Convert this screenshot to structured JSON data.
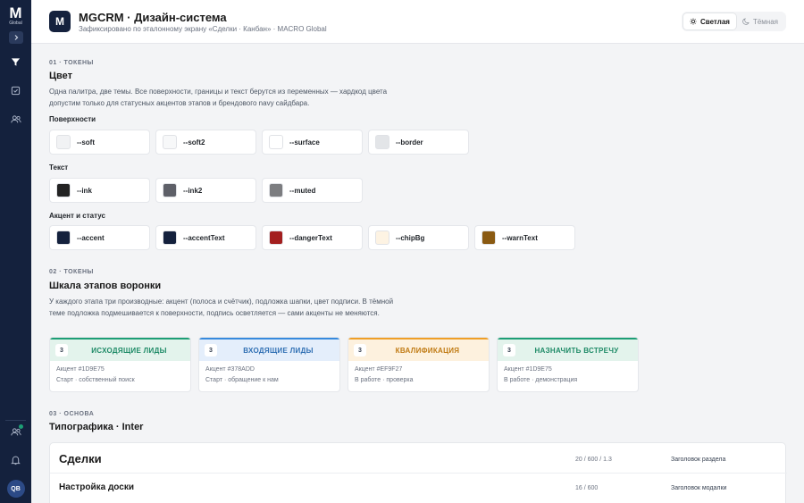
{
  "sidebar": {
    "logo_letter": "M",
    "logo_sub": "Global",
    "avatar": "QB"
  },
  "header": {
    "brand_letter": "M",
    "title": "MGCRM · Дизайн-система",
    "subtitle": "Зафиксировано по эталонному экрану «Сделки · Канбан» · MACRO Global",
    "theme_light": "Светлая",
    "theme_dark": "Тёмная"
  },
  "colors_section": {
    "eyebrow": "01 · ТОКЕНЫ",
    "title": "Цвет",
    "description": "Одна палитра, две темы. Все поверхности, границы и текст берутся из переменных — хардкод цвета допустим только для статусных акцентов этапов и брендового navy сайдбара.",
    "groups": [
      {
        "label": "Поверхности",
        "swatches": [
          {
            "name": "--soft",
            "color": "#f1f2f4"
          },
          {
            "name": "--soft2",
            "color": "#f7f8f9"
          },
          {
            "name": "--surface",
            "color": "#ffffff"
          },
          {
            "name": "--border",
            "color": "#e3e5e8"
          }
        ]
      },
      {
        "label": "Текст",
        "swatches": [
          {
            "name": "--ink",
            "color": "#232323"
          },
          {
            "name": "--ink2",
            "color": "#5e6068"
          },
          {
            "name": "--muted",
            "color": "#7c7d80"
          }
        ]
      },
      {
        "label": "Акцент и статус",
        "swatches": [
          {
            "name": "--accent",
            "color": "#14213d"
          },
          {
            "name": "--accentText",
            "color": "#14213d"
          },
          {
            "name": "--dangerText",
            "color": "#a31f1f"
          },
          {
            "name": "--chipBg",
            "color": "#fdf3e3"
          },
          {
            "name": "--warnText",
            "color": "#8a5a12"
          }
        ]
      }
    ]
  },
  "stages_section": {
    "eyebrow": "02 · ТОКЕНЫ",
    "title": "Шкала этапов воронки",
    "description": "У каждого этапа три производные: акцент (полоса и счётчик), подложка шапки, цвет подписи. В тёмной теме подложка подмешивается к поверхности, подпись осветляется — сами акценты не меняются.",
    "stages": [
      {
        "count": "3",
        "title": "ИСХОДЯЩИЕ ЛИДЫ",
        "accent_label": "Акцент #1D9E75",
        "note": "Старт · собственный поиск",
        "accent": "#1d9e75",
        "bg": "#e3f3ec",
        "text": "#1d8a66"
      },
      {
        "count": "3",
        "title": "ВХОДЯЩИЕ ЛИДЫ",
        "accent_label": "Акцент #378ADD",
        "note": "Старт · обращение к нам",
        "accent": "#378add",
        "bg": "#e4eefb",
        "text": "#2f6fb3"
      },
      {
        "count": "3",
        "title": "КВАЛИФИКАЦИЯ",
        "accent_label": "Акцент #EF9F27",
        "note": "В работе · проверка",
        "accent": "#ef9f27",
        "bg": "#fdf1de",
        "text": "#c07a12"
      },
      {
        "count": "3",
        "title": "НАЗНАЧИТЬ ВСТРЕЧУ",
        "accent_label": "Акцент #1D9E75",
        "note": "В работе · демонстрация",
        "accent": "#1d9e75",
        "bg": "#e3f3ec",
        "text": "#1d8a66"
      }
    ]
  },
  "typography_section": {
    "eyebrow": "03 · ОСНОВА",
    "title": "Типографика · Inter",
    "rows": [
      {
        "sample": "Сделки",
        "spec": "20 / 600 / 1.3",
        "role": "Заголовок раздела"
      },
      {
        "sample": "Настройка доски",
        "spec": "16 / 600",
        "role": "Заголовок модалки"
      }
    ]
  }
}
